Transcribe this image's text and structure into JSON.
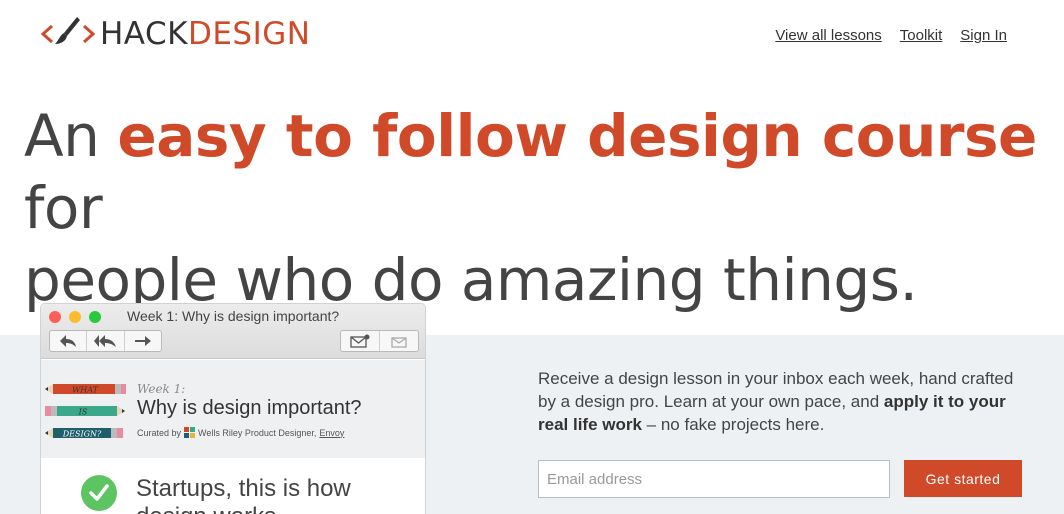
{
  "brand": {
    "hack": "HACK",
    "design": "DESIGN",
    "accent": "#d04a2a",
    "logo_icon": "brush-code-icon"
  },
  "nav": {
    "view_all": "View all lessons",
    "toolkit": "Toolkit",
    "sign_in": "Sign In"
  },
  "hero": {
    "line_a": "An",
    "emphasis": "easy to follow design course",
    "line_b": "for",
    "line_c": "people who do amazing things."
  },
  "mockup": {
    "window_title": "Week 1: Why is design important?",
    "toolbar_icons": [
      "reply-icon",
      "reply-all-icon",
      "forward-icon",
      "compose-icon",
      "archive-icon"
    ],
    "pencils": [
      "WHAT",
      "IS",
      "DESIGN?"
    ],
    "week_label": "Week 1:",
    "lesson_title": "Why is design important?",
    "curated_prefix": "Curated by",
    "curator": "Wells Riley Product Designer,",
    "curator_company": "Envoy",
    "body_title": "Startups, this is how design works"
  },
  "signup": {
    "pitch_text": "Receive a design lesson in your inbox each week, hand crafted by a design pro. Learn at your own pace, and",
    "pitch_bold": "apply it to your real life work",
    "pitch_tail": "– no fake projects here.",
    "email_placeholder": "Email address",
    "cta": "Get started"
  }
}
